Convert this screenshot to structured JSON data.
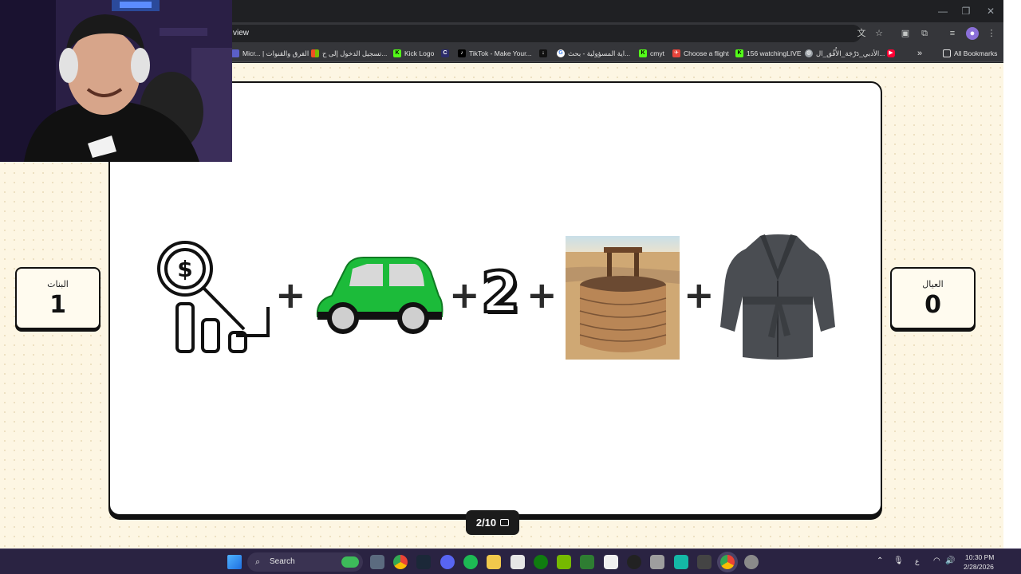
{
  "browser": {
    "url": "view",
    "bookmarks": [
      {
        "label": "Micr... | الفرق والقنوات",
        "color": "#5b5fc7",
        "glyph": ""
      },
      {
        "label": "تسجيل الدخول إلى ح...",
        "color": "#f25022",
        "glyph": ""
      },
      {
        "label": "Kick Logo",
        "color": "#53fc18",
        "glyph": "K"
      },
      {
        "label": "",
        "color": "#2c2c6a",
        "glyph": "C"
      },
      {
        "label": "TikTok - Make Your...",
        "color": "#000000",
        "glyph": "♪"
      },
      {
        "label": "",
        "color": "#111111",
        "glyph": "↓"
      },
      {
        "label": "اية المسؤولية - بحث...",
        "color": "#ffffff",
        "glyph": "G"
      },
      {
        "label": "cmyt",
        "color": "#53fc18",
        "glyph": "K"
      },
      {
        "label": "Choose a flight",
        "color": "#e8453c",
        "glyph": "✈"
      },
      {
        "label": "156 watchingLIVE",
        "color": "#53fc18",
        "glyph": "K"
      },
      {
        "label": "الأدبي_دَرْجَة_الأُفُق_ال...",
        "color": "#9aa0a6",
        "glyph": "◍"
      },
      {
        "label": "",
        "color": "#ff0033",
        "glyph": "▶"
      }
    ],
    "overflow_label": "»",
    "all_bookmarks_label": "All Bookmarks"
  },
  "game": {
    "girls_team": {
      "label": "البنات",
      "score": "1"
    },
    "boys_team": {
      "label": "العيال",
      "score": "0"
    },
    "puzzle": {
      "items": [
        "money-decline-icon",
        "green-car",
        "number-two",
        "brick-well",
        "bathrobe"
      ],
      "number_text": "2",
      "plus_sign": "+"
    },
    "progress": "2/10"
  },
  "taskbar": {
    "search_placeholder": "Search",
    "language": "ع",
    "time": "10:30 PM",
    "date": "2/28/2026"
  }
}
